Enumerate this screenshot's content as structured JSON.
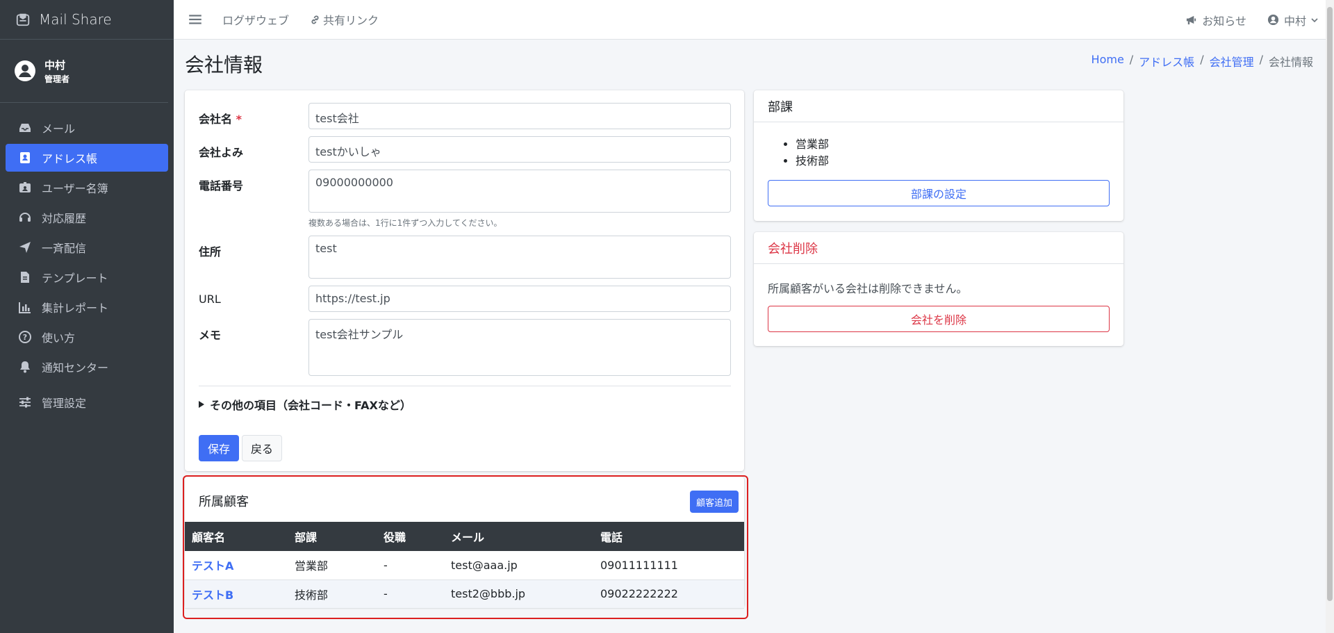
{
  "brand": {
    "name": "Mail Share"
  },
  "user": {
    "name": "中村",
    "role": "管理者"
  },
  "sidebar": {
    "items": [
      {
        "label": "メール",
        "icon": "inbox-icon"
      },
      {
        "label": "アドレス帳",
        "icon": "address-book-icon",
        "active": true
      },
      {
        "label": "ユーザー名簿",
        "icon": "id-badge-icon"
      },
      {
        "label": "対応履歴",
        "icon": "headset-icon"
      },
      {
        "label": "一斉配信",
        "icon": "paper-plane-icon"
      },
      {
        "label": "テンプレート",
        "icon": "file-icon"
      },
      {
        "label": "集計レポート",
        "icon": "bar-chart-icon"
      },
      {
        "label": "使い方",
        "icon": "question-circle-icon"
      },
      {
        "label": "通知センター",
        "icon": "bell-icon"
      },
      {
        "label": "管理設定",
        "icon": "sliders-icon"
      }
    ]
  },
  "topbar": {
    "links": [
      "ログザウェブ",
      "共有リンク"
    ],
    "notice": "お知らせ",
    "user": "中村"
  },
  "page": {
    "title": "会社情報"
  },
  "breadcrumb": [
    "Home",
    "アドレス帳",
    "会社管理",
    "会社情報"
  ],
  "form": {
    "company_name_label": "会社名",
    "required_mark": "*",
    "company_name": "test会社",
    "company_kana_label": "会社よみ",
    "company_kana": "testかいしゃ",
    "phone_label": "電話番号",
    "phone": "09000000000",
    "phone_hint": "複数ある場合は、1行に1件ずつ入力してください。",
    "address_label": "住所",
    "address": "test",
    "url_label": "URL",
    "url": "https://test.jp",
    "memo_label": "メモ",
    "memo": "test会社サンプル",
    "more_fields": "その他の項目（会社コード・FAXなど）",
    "save": "保存",
    "back": "戻る"
  },
  "departments": {
    "title": "部課",
    "items": [
      "営業部",
      "技術部"
    ],
    "settings_button": "部課の設定"
  },
  "delete": {
    "title": "会社削除",
    "message": "所属顧客がいる会社は削除できません。",
    "button": "会社を削除"
  },
  "customers": {
    "title": "所属顧客",
    "add_button": "顧客追加",
    "columns": [
      "顧客名",
      "部課",
      "役職",
      "メール",
      "電話"
    ],
    "rows": [
      [
        "テストA",
        "営業部",
        "-",
        "test@aaa.jp",
        "09011111111"
      ],
      [
        "テストB",
        "技術部",
        "-",
        "test2@bbb.jp",
        "09022222222"
      ]
    ]
  },
  "colors": {
    "primary": "#3f6ef4",
    "danger": "#dc3545",
    "sidebar": "#343a40"
  }
}
